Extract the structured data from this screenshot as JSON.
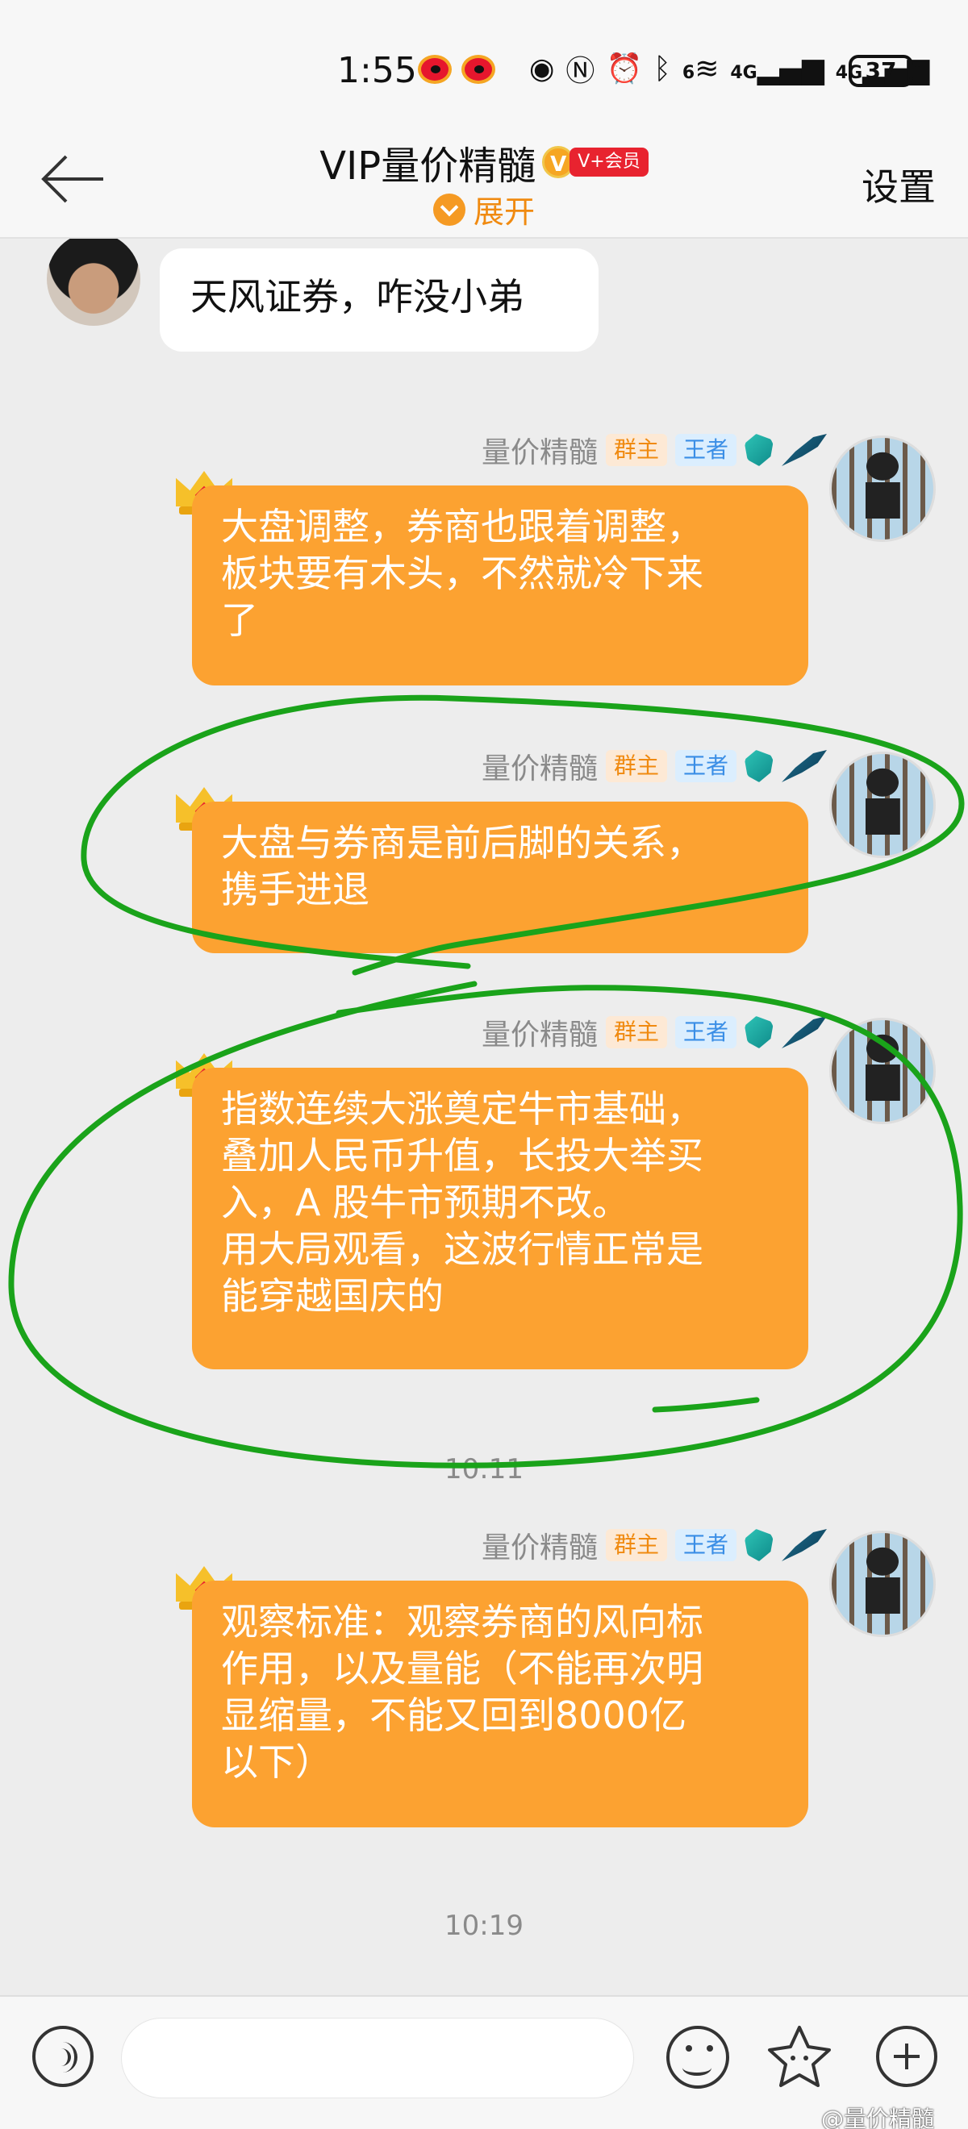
{
  "status_bar": {
    "time": "1:55",
    "net_label_1": "4G",
    "net_label_2": "4G",
    "wifi_label": "6",
    "battery": "37"
  },
  "header": {
    "title": "VIP量价精髓",
    "vip_badge_icon": "V",
    "vip_label": "V+会员",
    "expand_label": "展开",
    "settings_label": "设置"
  },
  "messages": [
    {
      "side": "left",
      "text": "天风证券，咋没小弟"
    },
    {
      "side": "right",
      "sender": "量价精髓",
      "tags": [
        "群主",
        "王者"
      ],
      "text": "大盘调整，券商也跟着调整，\n板块要有木头，不然就冷下来\n了"
    },
    {
      "side": "right",
      "sender": "量价精髓",
      "tags": [
        "群主",
        "王者"
      ],
      "text": "大盘与券商是前后脚的关系，\n携手进退"
    },
    {
      "side": "right",
      "sender": "量价精髓",
      "tags": [
        "群主",
        "王者"
      ],
      "text": "指数连续大涨奠定牛市基础，\n叠加人民币升值，长投大举买\n入，A 股牛市预期不改。\n用大局观看，这波行情正常是\n能穿越国庆的"
    },
    {
      "side": "right",
      "sender": "量价精髓",
      "tags": [
        "群主",
        "王者"
      ],
      "text": "观察标准：观察券商的风向标\n作用，以及量能（不能再次明\n显缩量，不能又回到8000亿\n以下）"
    }
  ],
  "timestamps": [
    "10:11",
    "10:19"
  ],
  "input_bar": {
    "placeholder": ""
  },
  "watermark": "@量价精髓",
  "colors": {
    "bubble_orange": "#fca231",
    "annotation_green": "#1aa31a",
    "tag_owner": "#f08a10",
    "tag_king": "#3a8ee6"
  },
  "icons": [
    "back-arrow-icon",
    "voice-icon",
    "emoji-icon",
    "sticker-icon",
    "plus-icon",
    "crown-icon"
  ]
}
